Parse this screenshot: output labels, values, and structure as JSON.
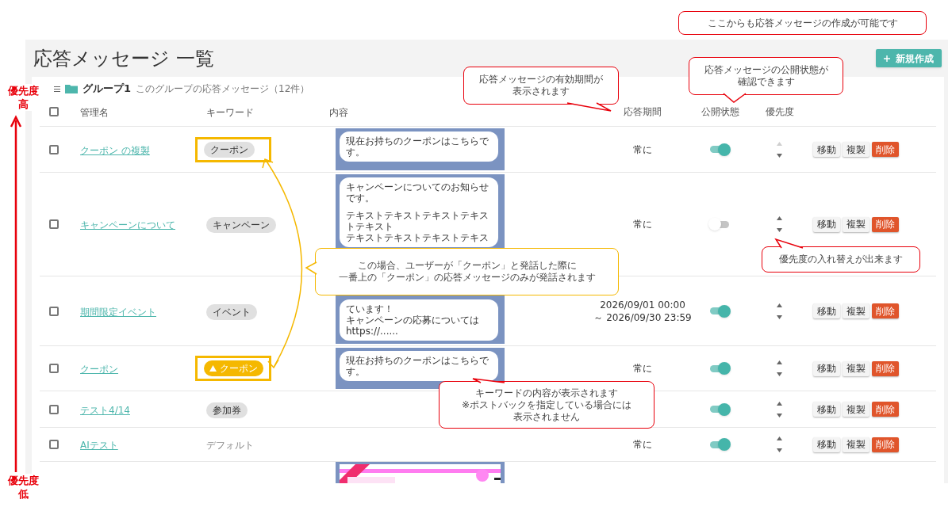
{
  "page": {
    "title": "応答メッセージ 一覧",
    "new_button": "新規作成"
  },
  "group": {
    "name": "グループ1",
    "caption": "このグループの応答メッセージ（12件）"
  },
  "columns": [
    "管理名",
    "キーワード",
    "内容",
    "応答期間",
    "公開状態",
    "優先度"
  ],
  "header_checkbox": {
    "checked": false
  },
  "rows": [
    {
      "kind": "message",
      "checked": false,
      "name": "クーポン の複製",
      "keyword": {
        "kind": "chip",
        "text": "クーポン"
      },
      "highlighted": true,
      "content": [
        "現在お持ちのクーポンはこちらで",
        "す。"
      ],
      "period": [
        "常に"
      ],
      "published": true,
      "up_disabled": true,
      "actions": [
        {
          "kind": "default",
          "text": "移動"
        },
        {
          "kind": "default",
          "text": "複製"
        },
        {
          "kind": "danger",
          "text": "削除"
        }
      ]
    },
    {
      "kind": "message",
      "checked": false,
      "name": "キャンペーンについて",
      "keyword": {
        "kind": "chip",
        "text": "キャンペーン"
      },
      "highlighted": false,
      "content": [
        "キャンペーンについてのお知らせ",
        "です。",
        "テキストテキストテキストテキス",
        "トテキスト",
        "テキストテキストテキストテキス"
      ],
      "period": [
        "常に"
      ],
      "published": false,
      "up_disabled": false,
      "actions": [
        {
          "kind": "default",
          "text": "移動"
        },
        {
          "kind": "default",
          "text": "複製"
        },
        {
          "kind": "danger",
          "text": "削除"
        }
      ]
    },
    {
      "kind": "message",
      "checked": false,
      "name": "期間限定イベント",
      "keyword": {
        "kind": "chip",
        "text": "イベント"
      },
      "highlighted": false,
      "content": [
        "ています！",
        "キャンペーンの応募については",
        "https://......"
      ],
      "period": [
        "2026/09/01 00:00",
        "～ 2026/09/30 23:59"
      ],
      "published": true,
      "up_disabled": false,
      "actions": [
        {
          "kind": "default",
          "text": "移動"
        },
        {
          "kind": "default",
          "text": "複製"
        },
        {
          "kind": "danger",
          "text": "削除"
        }
      ]
    },
    {
      "kind": "message",
      "checked": false,
      "name": "クーポン",
      "keyword": {
        "kind": "warning_chip",
        "text": "クーポン"
      },
      "highlighted": true,
      "content": [
        "現在お持ちのクーポンはこちらで",
        "す。"
      ],
      "period": [
        "常に"
      ],
      "published": true,
      "up_disabled": false,
      "actions": [
        {
          "kind": "default",
          "text": "移動"
        },
        {
          "kind": "default",
          "text": "複製"
        },
        {
          "kind": "danger",
          "text": "削除"
        }
      ]
    },
    {
      "kind": "message",
      "checked": false,
      "name": "テスト4/14",
      "keyword": {
        "kind": "chip",
        "text": "参加券"
      },
      "highlighted": false,
      "published": true,
      "up_disabled": false,
      "actions": [
        {
          "kind": "default",
          "text": "移動"
        },
        {
          "kind": "default",
          "text": "複製"
        },
        {
          "kind": "danger",
          "text": "削除"
        }
      ]
    },
    {
      "kind": "message",
      "checked": false,
      "name": "AIテスト",
      "keyword": {
        "kind": "plain",
        "text": "デフォルト"
      },
      "highlighted": false,
      "period": [
        "常に"
      ],
      "published": true,
      "up_disabled": false,
      "actions": [
        {
          "kind": "default",
          "text": "移動"
        },
        {
          "kind": "default",
          "text": "複製"
        },
        {
          "kind": "danger",
          "text": "削除"
        }
      ]
    },
    {
      "kind": "picture"
    }
  ],
  "priority_axis": {
    "top": [
      "優先度",
      "高"
    ],
    "bottom": [
      "優先度",
      "低"
    ]
  },
  "callouts": [
    {
      "kind": "red",
      "lines": [
        "ここからも応答メッセージの作成が可能です"
      ]
    },
    {
      "kind": "red",
      "lines": [
        "応答メッセージの有効期間が",
        "表示されます"
      ]
    },
    {
      "kind": "red",
      "lines": [
        "応答メッセージの公開状態が",
        "確認できます"
      ]
    },
    {
      "kind": "red",
      "lines": [
        "優先度の入れ替えが出来ます"
      ]
    },
    {
      "kind": "yellow",
      "lines": [
        "この場合、ユーザーが「クーポン」と発話した際に",
        "一番上の「クーポン」の応答メッセージのみが発話されます"
      ]
    },
    {
      "kind": "red",
      "lines": [
        "キーワードの内容が表示されます",
        "※ポストバックを指定している場合には",
        "表示されません"
      ]
    }
  ]
}
